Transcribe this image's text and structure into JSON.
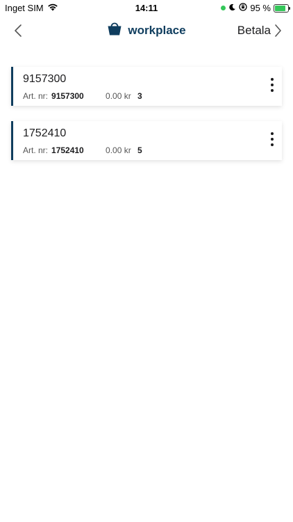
{
  "status_bar": {
    "carrier": "Inget SIM",
    "time": "14:11",
    "battery_percent": "95 %",
    "battery_level": 0.95,
    "icons": [
      "wifi-icon",
      "moon-icon",
      "orientation-lock-icon",
      "battery-charging-icon"
    ]
  },
  "nav": {
    "brand": "workplace",
    "next_label": "Betala",
    "icons": [
      "chevron-left-icon",
      "basket-icon",
      "chevron-right-icon"
    ]
  },
  "colors": {
    "brand": "#0f3d5e",
    "status_green": "#34c759"
  },
  "cart": {
    "items": [
      {
        "title": "9157300",
        "art_label": "Art. nr:",
        "art_number": "9157300",
        "price": "0.00 kr",
        "quantity": "3"
      },
      {
        "title": "1752410",
        "art_label": "Art. nr:",
        "art_number": "1752410",
        "price": "0.00 kr",
        "quantity": "5"
      }
    ]
  }
}
